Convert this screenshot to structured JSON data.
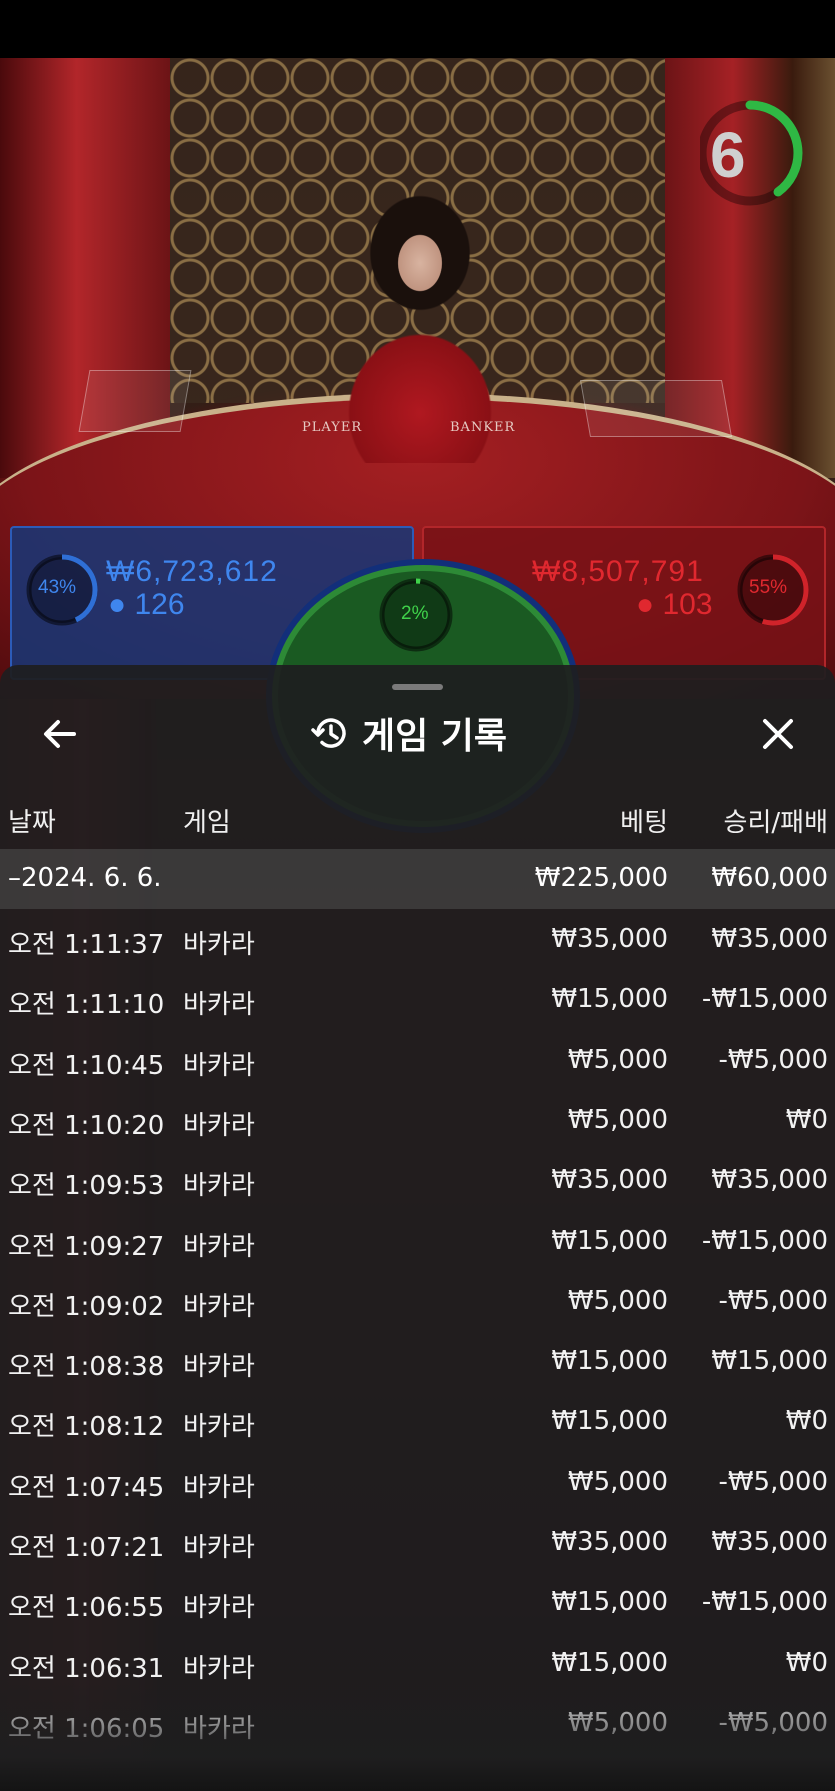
{
  "status_bar": {},
  "video": {
    "table_labels": {
      "player": "PLAYER",
      "banker": "BANKER"
    },
    "timer": {
      "seconds": "6",
      "progress_fraction": 0.4,
      "color": "#2fb844"
    }
  },
  "bet_summary": {
    "player": {
      "percent": "43%",
      "amount": "₩6,723,612",
      "count": "126",
      "color": "#2f6fd6"
    },
    "tie": {
      "percent": "2%",
      "color": "#3fd24a"
    },
    "banker": {
      "percent": "55%",
      "amount": "₩8,507,791",
      "count": "103",
      "color": "#d0232a"
    }
  },
  "history_sheet": {
    "title": "게임 기록",
    "columns": {
      "date": "날짜",
      "game": "게임",
      "bet": "베팅",
      "result": "승리/패배"
    },
    "date_group": {
      "label": "–2024. 6. 6.",
      "bet_total": "₩225,000",
      "result_total": "₩60,000"
    },
    "rows": [
      {
        "time": "오전 1:11:37",
        "game": "바카라",
        "bet": "₩35,000",
        "result": "₩35,000"
      },
      {
        "time": "오전 1:11:10",
        "game": "바카라",
        "bet": "₩15,000",
        "result": "-₩15,000"
      },
      {
        "time": "오전 1:10:45",
        "game": "바카라",
        "bet": "₩5,000",
        "result": "-₩5,000"
      },
      {
        "time": "오전 1:10:20",
        "game": "바카라",
        "bet": "₩5,000",
        "result": "₩0"
      },
      {
        "time": "오전 1:09:53",
        "game": "바카라",
        "bet": "₩35,000",
        "result": "₩35,000"
      },
      {
        "time": "오전 1:09:27",
        "game": "바카라",
        "bet": "₩15,000",
        "result": "-₩15,000"
      },
      {
        "time": "오전 1:09:02",
        "game": "바카라",
        "bet": "₩5,000",
        "result": "-₩5,000"
      },
      {
        "time": "오전 1:08:38",
        "game": "바카라",
        "bet": "₩15,000",
        "result": "₩15,000"
      },
      {
        "time": "오전 1:08:12",
        "game": "바카라",
        "bet": "₩15,000",
        "result": "₩0"
      },
      {
        "time": "오전 1:07:45",
        "game": "바카라",
        "bet": "₩5,000",
        "result": "-₩5,000"
      },
      {
        "time": "오전 1:07:21",
        "game": "바카라",
        "bet": "₩35,000",
        "result": "₩35,000"
      },
      {
        "time": "오전 1:06:55",
        "game": "바카라",
        "bet": "₩15,000",
        "result": "-₩15,000"
      },
      {
        "time": "오전 1:06:31",
        "game": "바카라",
        "bet": "₩15,000",
        "result": "₩0"
      },
      {
        "time": "오전 1:06:05",
        "game": "바카라",
        "bet": "₩5,000",
        "result": "-₩5,000"
      }
    ],
    "icons": {
      "back": "arrow-left-icon",
      "history": "history-clock-icon",
      "close": "close-icon"
    }
  }
}
